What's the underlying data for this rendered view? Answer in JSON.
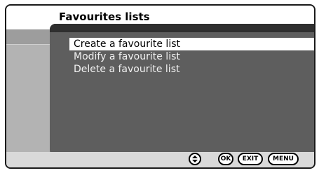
{
  "header": {
    "title": "Favourites lists"
  },
  "menu": {
    "items": [
      {
        "label": "Create a favourite list",
        "selected": true
      },
      {
        "label": "Modify a favourite list",
        "selected": false
      },
      {
        "label": "Delete a favourite list",
        "selected": false
      }
    ]
  },
  "footer": {
    "buttons": [
      {
        "icon": "up-down-nav-icon",
        "label": ""
      },
      {
        "icon": "ok-button-icon",
        "label": "OK"
      },
      {
        "icon": "exit-button-icon",
        "label": "EXIT"
      },
      {
        "icon": "menu-button-icon",
        "label": "MENU"
      }
    ]
  },
  "colors": {
    "menu_bg": "#5e5e5e",
    "selected_bg": "#ffffff",
    "screen_bg": "#9d9d9d"
  }
}
